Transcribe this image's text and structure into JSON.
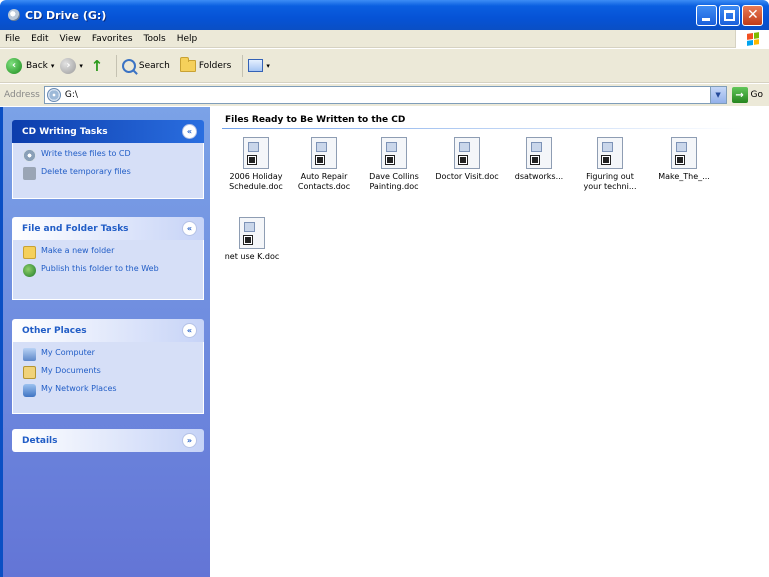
{
  "window": {
    "title": "CD Drive (G:)"
  },
  "menubar": {
    "items": [
      "File",
      "Edit",
      "View",
      "Favorites",
      "Tools",
      "Help"
    ]
  },
  "toolbar": {
    "back_label": "Back",
    "search_label": "Search",
    "folders_label": "Folders"
  },
  "address": {
    "label": "Address",
    "value": "G:\\",
    "go_label": "Go"
  },
  "taskpane": {
    "cd_writing": {
      "title": "CD Writing Tasks",
      "tasks": [
        "Write these files to CD",
        "Delete temporary files"
      ]
    },
    "file_folder": {
      "title": "File and Folder Tasks",
      "tasks": [
        "Make a new folder",
        "Publish this folder to the Web"
      ]
    },
    "other_places": {
      "title": "Other Places",
      "items": [
        "My Computer",
        "My Documents",
        "My Network Places"
      ]
    },
    "details": {
      "title": "Details"
    }
  },
  "content": {
    "group_title": "Files Ready to Be Written to the CD",
    "files": [
      {
        "name": "2006 Holiday Schedule.doc",
        "icon": "word-document-icon"
      },
      {
        "name": "Auto Repair Contacts.doc",
        "icon": "word-document-icon"
      },
      {
        "name": "Dave Collins Painting.doc",
        "icon": "word-document-icon"
      },
      {
        "name": "Doctor Visit.doc",
        "icon": "word-document-icon"
      },
      {
        "name": "dsatworks...",
        "icon": "word-document-icon"
      },
      {
        "name": "Figuring out your techni...",
        "icon": "word-document-icon"
      },
      {
        "name": "Make_The_...",
        "icon": "word-document-icon"
      },
      {
        "name": "net use K.doc",
        "icon": "word-document-icon"
      }
    ]
  },
  "colors": {
    "title_bar": "#0653d6",
    "task_pane": "#7ba2e7",
    "link_blue": "#215dc6"
  }
}
